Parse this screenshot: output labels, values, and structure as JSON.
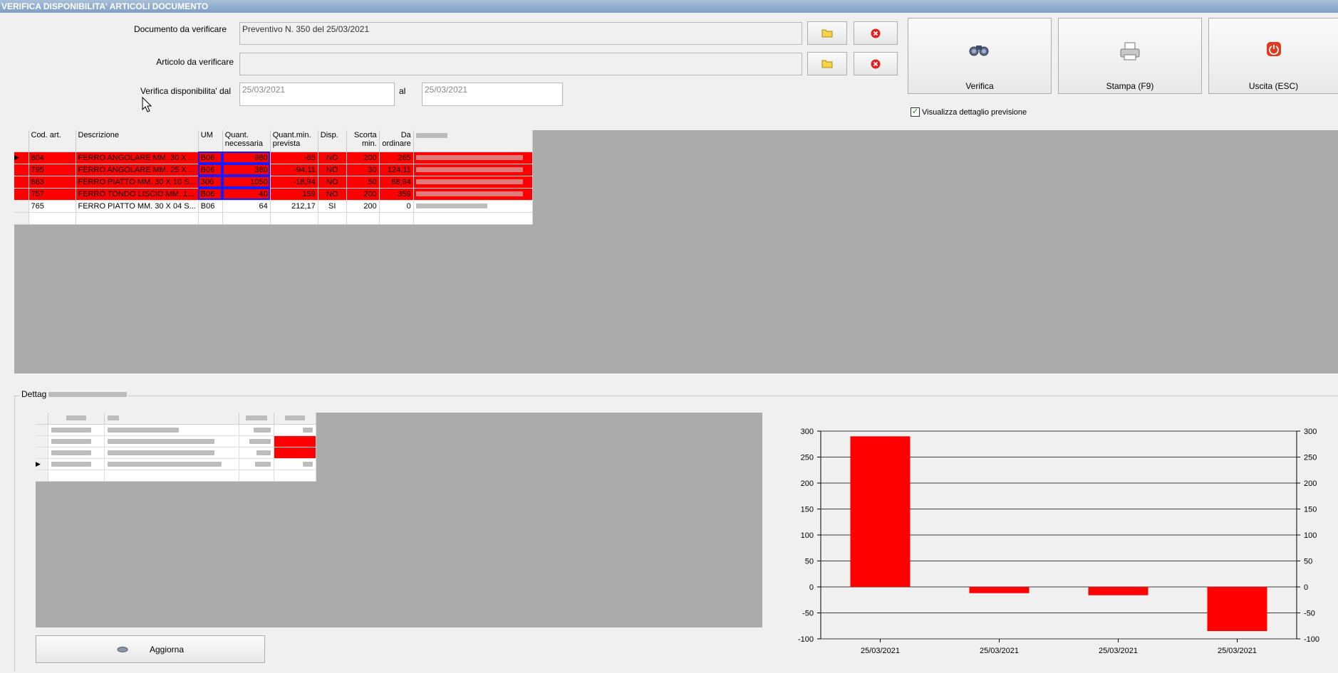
{
  "window": {
    "title": "VERIFICA DISPONIBILITA' ARTICOLI DOCUMENTO"
  },
  "form": {
    "documento_label": "Documento da verificare",
    "documento_value": "Preventivo N. 350 del 25/03/2021",
    "articolo_label": "Articolo da verificare",
    "articolo_value": "",
    "dal_label": "Verifica disponibilita' dal",
    "dal_value": "25/03/2021",
    "al_label": "al",
    "al_value": "25/03/2021"
  },
  "buttons": {
    "verifica": "Verifica",
    "stampa": "Stampa (F9)",
    "uscita": "Uscita (ESC)",
    "aggiorna": "Aggiorna"
  },
  "checkbox": {
    "label": "Visualizza dettaglio previsione",
    "checked": true
  },
  "grid": {
    "columns": [
      "Cod. art.",
      "Descrizione",
      "UM",
      "Quant. necessaria",
      "Quant.min. prevista",
      "Disp.",
      "Scorta min.",
      "Da ordinare"
    ],
    "rows": [
      {
        "cod": "804",
        "desc": "FERRO ANGOLARE MM. 30 X ...",
        "um": "B06",
        "qnec": "980",
        "qmin": "-65",
        "disp": "NO",
        "scorta": "200",
        "daord": "265",
        "red": true
      },
      {
        "cod": "795",
        "desc": "FERRO ANGOLARE MM. 25 X ...",
        "um": "B06",
        "qnec": "380",
        "qmin": "-94,11",
        "disp": "NO",
        "scorta": "30",
        "daord": "124,11",
        "red": true
      },
      {
        "cod": "863",
        "desc": "FERRO PIATTO MM. 30 X 10 S...",
        "um": "306",
        "qnec": "1050",
        "qmin": "-18,94",
        "disp": "NO",
        "scorta": "50",
        "daord": "68,94",
        "red": true
      },
      {
        "cod": "757",
        "desc": "FERRO TONDO LISCIO MM. 1...",
        "um": "B06",
        "qnec": "40",
        "qmin": "159",
        "disp": "NO",
        "scorta": "200",
        "daord": "359",
        "red": true
      },
      {
        "cod": "765",
        "desc": "FERRO PIATTO MM. 30 X 04 S...",
        "um": "B06",
        "qnec": "64",
        "qmin": "212,17",
        "disp": "SI",
        "scorta": "200",
        "daord": "0",
        "red": false
      }
    ]
  },
  "detail": {
    "group_label": "Dettag"
  },
  "colors": {
    "alert": "#ff0000",
    "highlight": "#1a1aff",
    "grid_bg": "#ababab"
  },
  "chart_data": {
    "type": "bar",
    "categories": [
      "25/03/2021",
      "25/03/2021",
      "25/03/2021",
      "25/03/2021"
    ],
    "values": [
      290,
      -12,
      -16,
      -85
    ],
    "ylim": [
      -100,
      300
    ],
    "yticks": [
      300,
      250,
      200,
      150,
      100,
      50,
      0,
      -50,
      -100
    ],
    "grid": true,
    "color": "#ff0000"
  }
}
